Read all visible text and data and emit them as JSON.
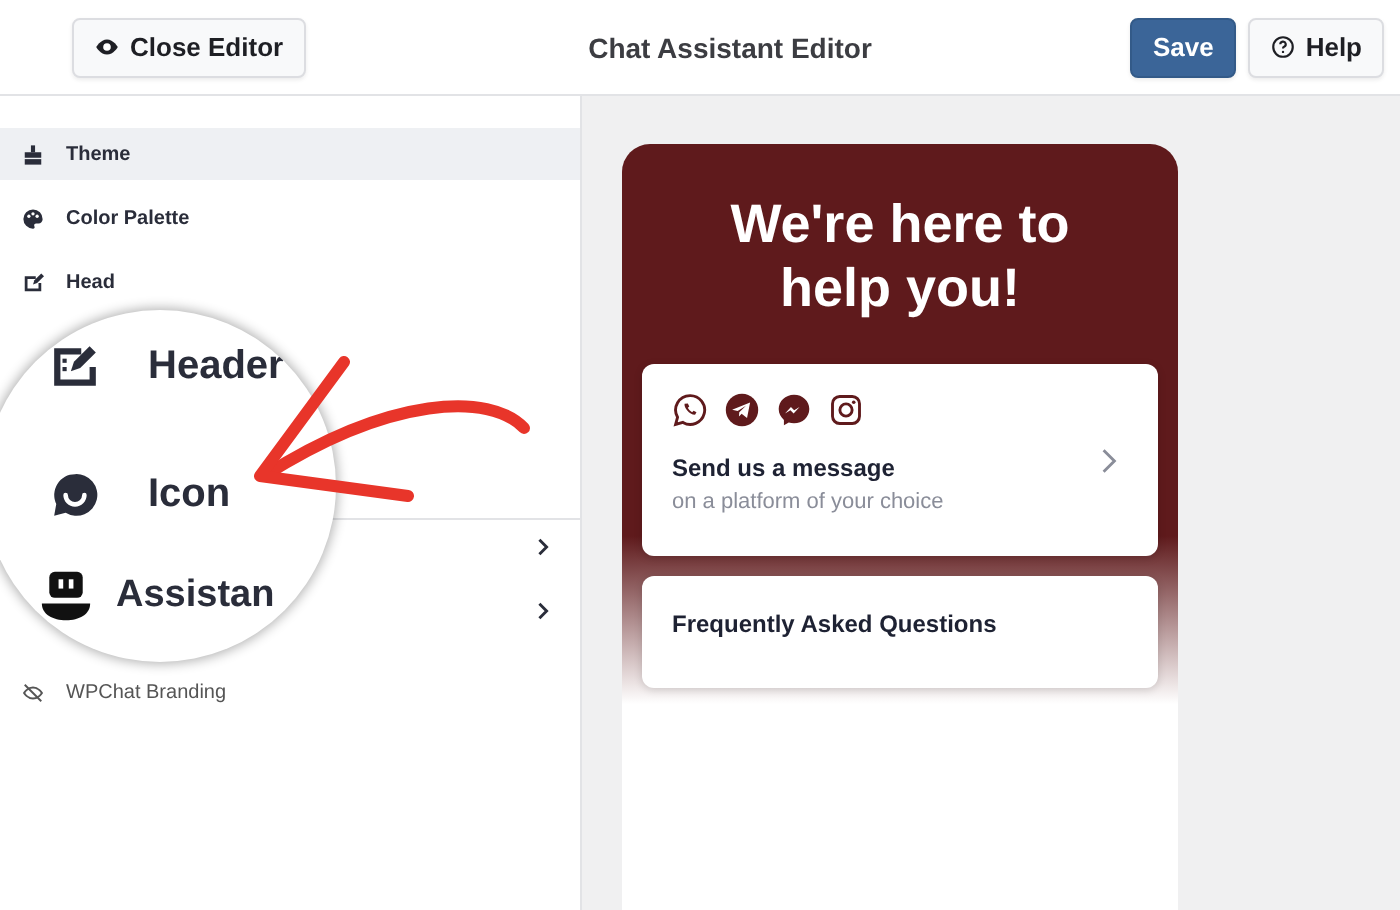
{
  "topbar": {
    "close_button": "Close Editor",
    "title": "Chat Assistant Editor",
    "save_button": "Save",
    "help_button": "Help"
  },
  "sidebar": {
    "items": [
      {
        "label": "Theme",
        "selected": true
      },
      {
        "label": "Color Palette",
        "selected": false
      },
      {
        "label": "Head",
        "selected": false
      }
    ],
    "footer_item": {
      "label": "WPChat Branding"
    }
  },
  "magnifier": {
    "items": [
      {
        "label": "Header",
        "kind": "header"
      },
      {
        "label": "Icon",
        "kind": "icon"
      },
      {
        "label": "Assistan",
        "kind": "assistant"
      }
    ]
  },
  "preview": {
    "heading": "We're here to help you!",
    "message_card": {
      "title": "Send us a message",
      "subtitle": "on a platform of your choice"
    },
    "faq_card": {
      "title": "Frequently Asked Questions"
    }
  }
}
